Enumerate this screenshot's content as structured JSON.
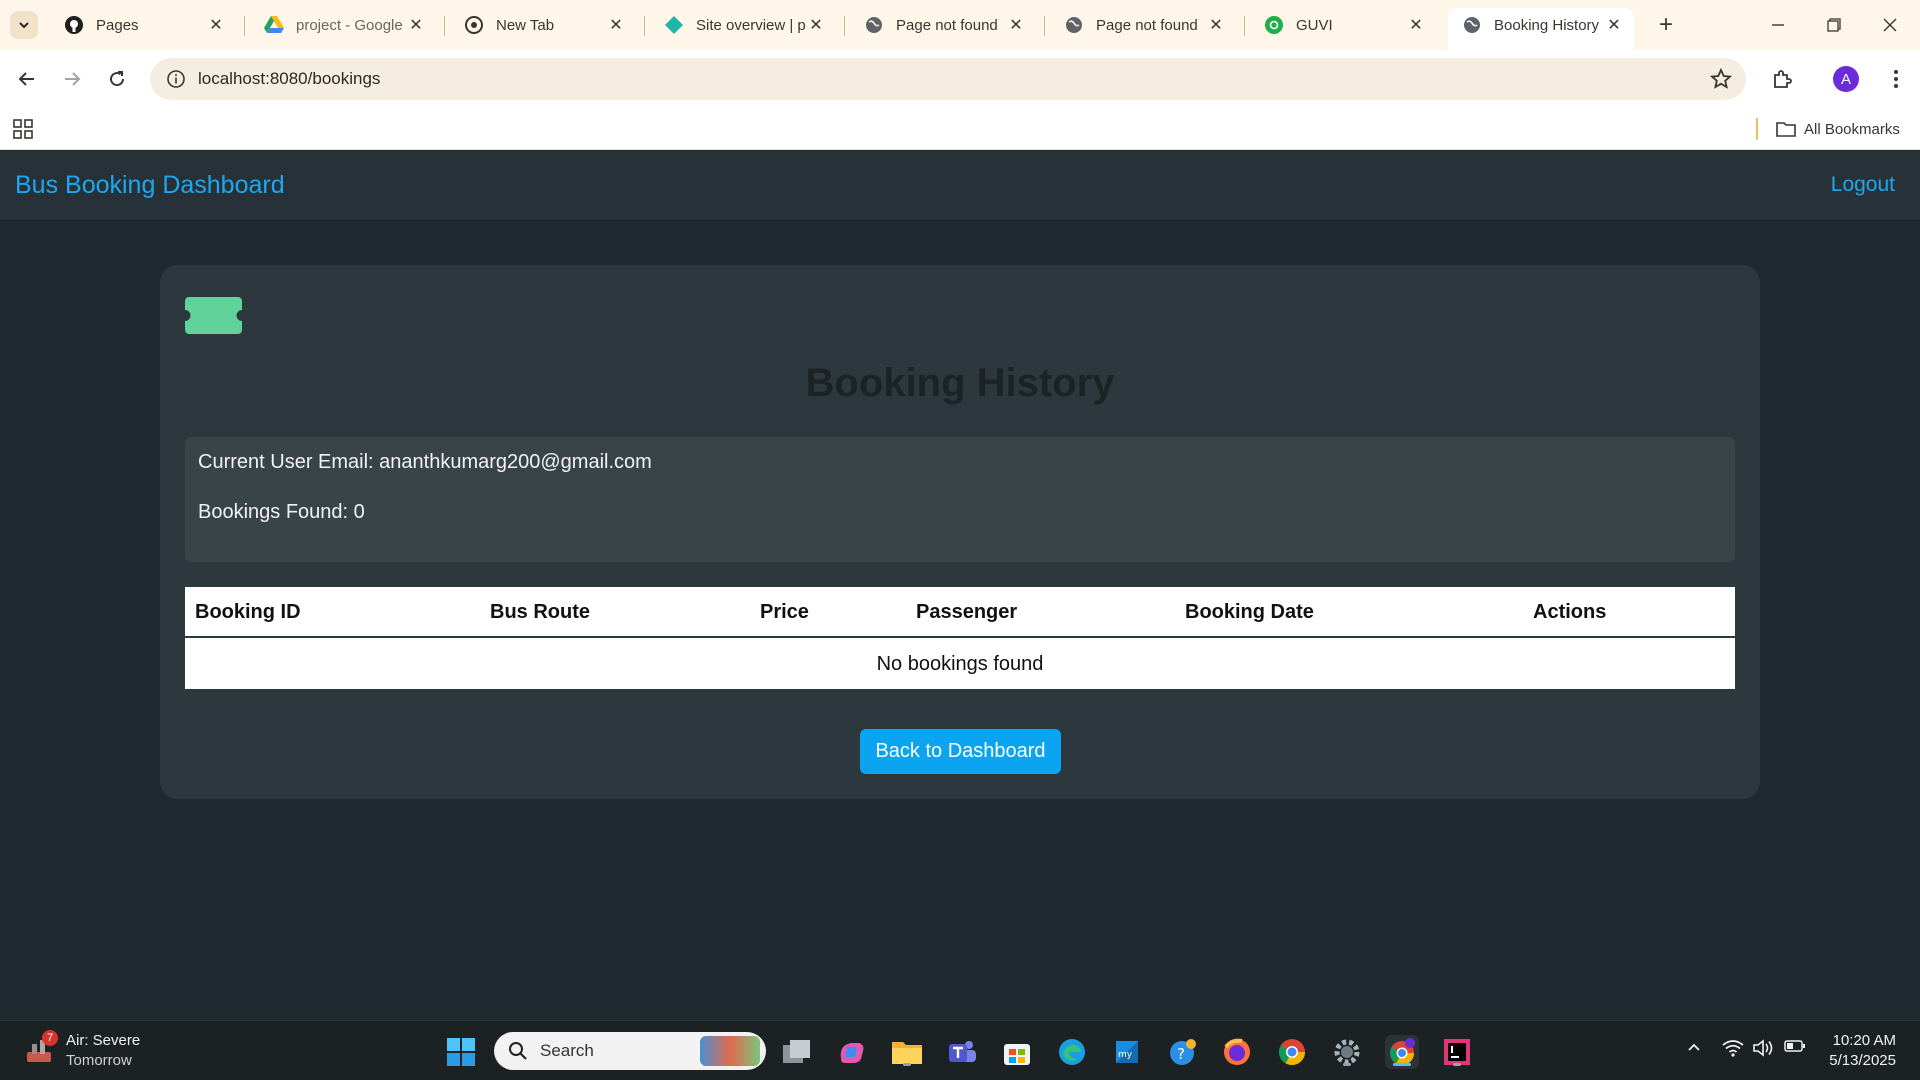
{
  "browser": {
    "tabs": [
      {
        "title": "Pages",
        "icon": "github-icon"
      },
      {
        "title": "project - Google",
        "icon": "google-drive-icon"
      },
      {
        "title": "New Tab",
        "icon": "chrome-icon"
      },
      {
        "title": "Site overview | p",
        "icon": "netlify-icon"
      },
      {
        "title": "Page not found",
        "icon": "globe-icon"
      },
      {
        "title": "Page not found",
        "icon": "globe-icon"
      },
      {
        "title": "GUVI",
        "icon": "guvi-icon"
      },
      {
        "title": "Booking History",
        "icon": "globe-icon",
        "active": true
      }
    ],
    "url": "localhost:8080/bookings",
    "profile_initial": "A",
    "bookmarks_label": "All Bookmarks"
  },
  "app": {
    "brand": "Bus Booking Dashboard",
    "logout": "Logout",
    "title": "Booking History",
    "user_email_line": "Current User Email: ananthkumarg200@gmail.com",
    "bookings_found_line": "Bookings Found: 0",
    "table": {
      "columns": [
        "Booking ID",
        "Bus Route",
        "Price",
        "Passenger",
        "Booking Date",
        "Actions"
      ],
      "empty_message": "No bookings found"
    },
    "back_button": "Back to Dashboard",
    "accent_color": "#1ea7f0",
    "ticket_icon_color": "#5fd39a"
  },
  "taskbar": {
    "weather_title": "Air: Severe",
    "weather_sub": "Tomorrow",
    "weather_badge": "7",
    "search_placeholder": "Search",
    "time": "10:20 AM",
    "date": "5/13/2025"
  }
}
